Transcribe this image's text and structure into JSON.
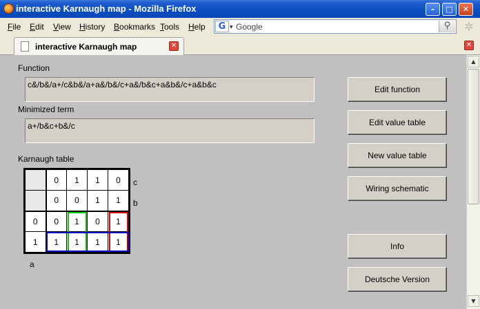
{
  "window": {
    "title": "interactive Karnaugh map - Mozilla Firefox",
    "min_symbol": "–",
    "max_symbol": "□",
    "close_symbol": "✕"
  },
  "menubar": {
    "items": [
      {
        "label": "File",
        "ul": "F",
        "rest": "ile"
      },
      {
        "label": "Edit",
        "ul": "E",
        "rest": "dit"
      },
      {
        "label": "View",
        "ul": "V",
        "rest": "iew"
      },
      {
        "label": "History",
        "ul": "H",
        "rest": "istory"
      },
      {
        "label": "Bookmarks",
        "ul": "B",
        "rest": "ookmarks"
      },
      {
        "label": "Tools",
        "ul": "T",
        "rest": "ools"
      },
      {
        "label": "Help",
        "ul": "H",
        "rest": "elp"
      }
    ]
  },
  "search": {
    "engine_glyph": "G",
    "value": "Google",
    "go_glyph": "⚲"
  },
  "tab": {
    "label": "interactive Karnaugh map"
  },
  "page": {
    "function_label": "Function",
    "function_value": "c&/b&/a+/c&b&/a+a&/b&/c+a&/b&c+a&b&/c+a&b&c",
    "minimized_label": "Minimized term",
    "minimized_value": "a+/b&c+b&/c",
    "kmap_label": "Karnaugh table",
    "buttons": {
      "edit_function": "Edit function",
      "edit_value_table": "Edit value table",
      "new_value_table": "New value table",
      "wiring_schematic": "Wiring schematic",
      "info": "Info",
      "deutsche_version": "Deutsche Version"
    }
  },
  "kmap": {
    "row_c": [
      "",
      "0",
      "1",
      "1",
      "0"
    ],
    "row_b": [
      "",
      "0",
      "0",
      "1",
      "1"
    ],
    "row_a0": [
      "0",
      "0",
      "1",
      "0",
      "1"
    ],
    "row_a1": [
      "1",
      "1",
      "1",
      "1",
      "1"
    ],
    "var_c": "c",
    "var_b": "b",
    "var_a": "a",
    "group_colors": {
      "green": "#00cc00",
      "red": "#e00000",
      "blue": "#0000c0"
    }
  }
}
